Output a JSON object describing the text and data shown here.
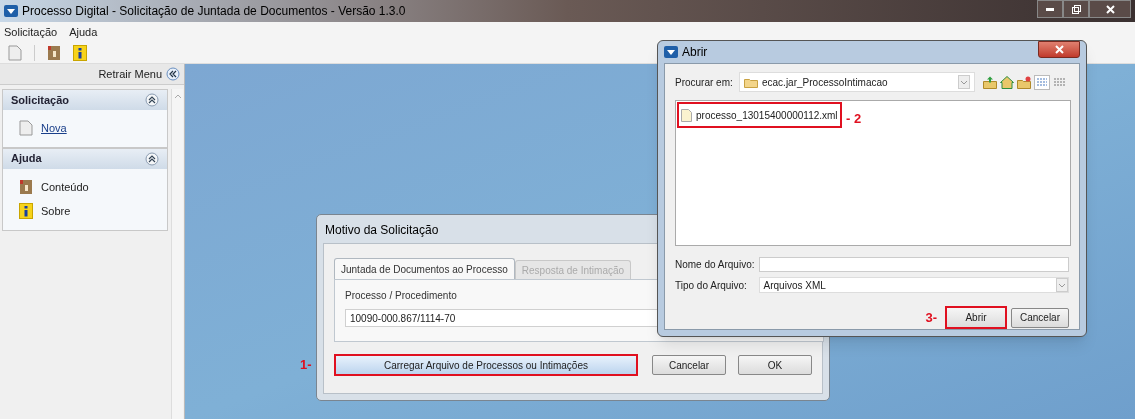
{
  "window": {
    "title": "Processo Digital - Solicitação de Juntada de Documentos - Versão 1.3.0"
  },
  "menu": [
    "Solicitação",
    "Ajuda"
  ],
  "sidebar": {
    "collapse_label": "Retrair Menu",
    "sections": [
      {
        "title": "Solicitação",
        "expanded": true,
        "items": [
          {
            "label": "Nova",
            "kind": "document",
            "link": true
          }
        ]
      },
      {
        "title": "Ajuda",
        "expanded": true,
        "items": [
          {
            "label": "Conteúdo",
            "kind": "help",
            "link": false
          },
          {
            "label": "Sobre",
            "kind": "info",
            "link": false
          }
        ]
      }
    ]
  },
  "motivo_dialog": {
    "title": "Motivo da Solicitação",
    "tabs": [
      {
        "label": "Juntada de Documentos ao Processo",
        "selected": true
      },
      {
        "label": "Resposta de Intimação",
        "selected": false
      }
    ],
    "field_label": "Processo / Procedimento",
    "field_value": "10090-000.867/1114-70",
    "load_button": {
      "label": "Carregar Arquivo de Processos ou Intimações",
      "highlighted": true
    },
    "annotation": "1-",
    "buttons": [
      "Cancelar",
      "OK"
    ]
  },
  "open_dialog": {
    "title": "Abrir",
    "look_in_label": "Procurar em:",
    "look_in_value": "ecac.jar_ProcessoIntimacao",
    "files": [
      {
        "name": "processo_13015400000112.xml",
        "highlighted": true
      }
    ],
    "file_annotation": "- 2",
    "name_label": "Nome do Arquivo:",
    "type_label": "Tipo do Arquivo:",
    "type_value": "Arquivos XML",
    "open_button": {
      "label": "Abrir",
      "highlighted": true
    },
    "open_annotation": "3-",
    "cancel_label": "Cancelar"
  }
}
